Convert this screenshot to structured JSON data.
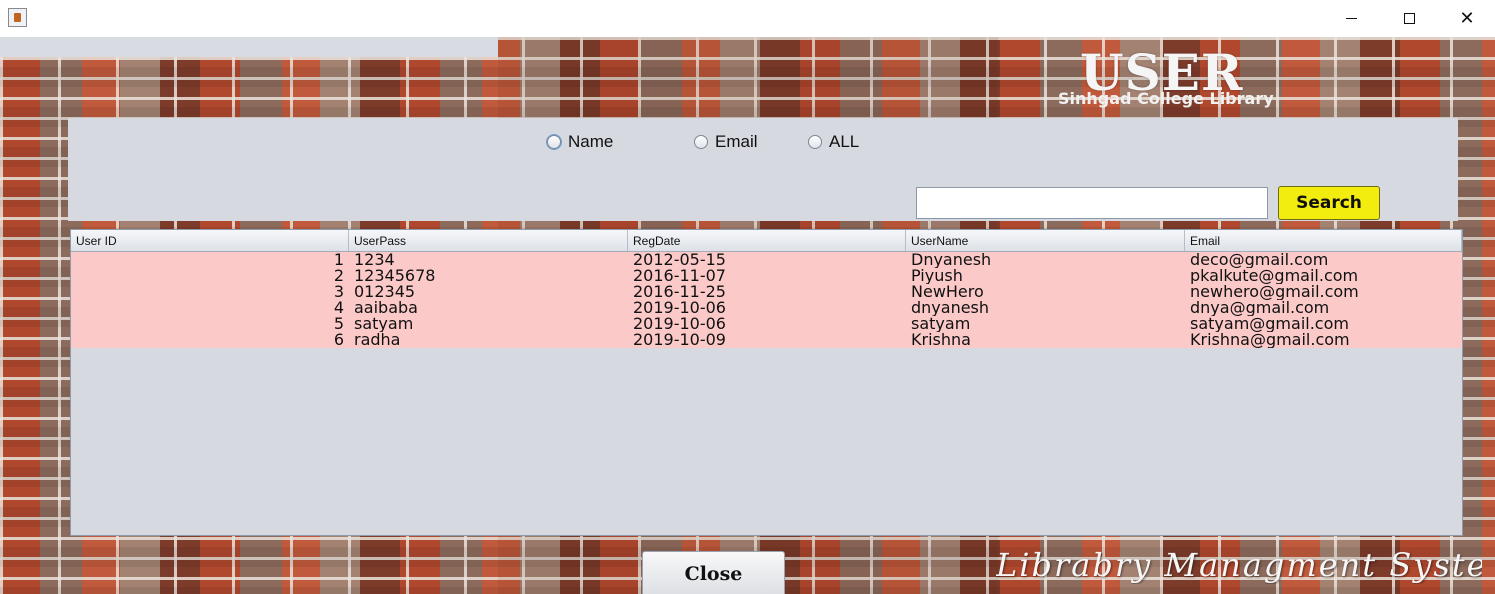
{
  "window": {
    "close_glyph": "✕"
  },
  "header": {
    "title": "USER",
    "subtitle": "Sinhgad College Library"
  },
  "search": {
    "radios": [
      {
        "label": "Name",
        "selected": false,
        "focused": true
      },
      {
        "label": "Email",
        "selected": false
      },
      {
        "label": "ALL",
        "selected": false
      }
    ],
    "input_value": "",
    "button_label": "Search",
    "button_color": "#f3ec0f"
  },
  "table": {
    "columns": [
      "User ID",
      "UserPass",
      "RegDate",
      "UserName",
      "Email"
    ],
    "rows": [
      [
        "1",
        "1234",
        "2012-05-15",
        "Dnyanesh",
        "deco@gmail.com"
      ],
      [
        "2",
        "12345678",
        "2016-11-07",
        "Piyush",
        "pkalkute@gmail.com"
      ],
      [
        "3",
        "012345",
        "2016-11-25",
        "NewHero",
        "newhero@gmail.com"
      ],
      [
        "4",
        "aaibaba",
        "2019-10-06",
        "dnyanesh",
        "dnya@gmail.com"
      ],
      [
        "5",
        "satyam",
        "2019-10-06",
        "satyam",
        "satyam@gmail.com"
      ],
      [
        "6",
        "radha",
        "2019-10-09",
        "Krishna",
        "Krishna@gmail.com"
      ]
    ],
    "row_color": "#fcc9c9"
  },
  "footer": {
    "close_label": "Close",
    "tagline": "Librabry Managment System"
  }
}
